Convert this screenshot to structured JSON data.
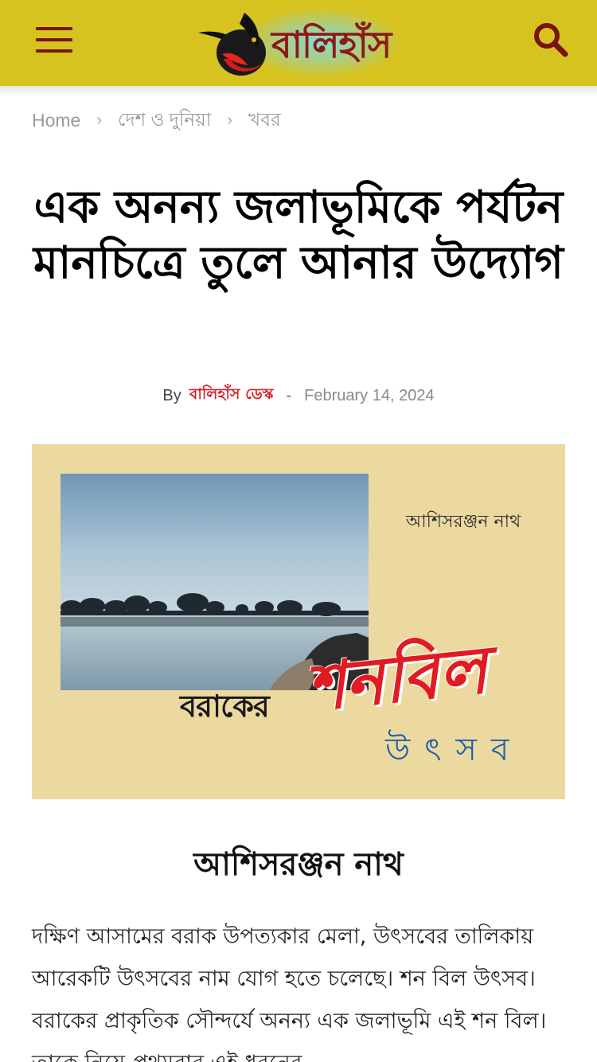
{
  "header": {
    "menu_icon": "hamburger-menu-icon",
    "logo_text": "বালিহাঁস",
    "search_icon": "search-icon",
    "bar_color": "#d6c31f",
    "brand_color": "#7a1414"
  },
  "breadcrumb": {
    "items": [
      "Home",
      "দেশ ও দুনিয়া",
      "খবর"
    ],
    "separator": "›"
  },
  "article": {
    "title": "এক অনন্য জলাভূমিকে পর্যটন মানচিত্রে তুলে আনার উদ্যোগ",
    "by_label": "By",
    "author": "বালিহাঁস ডেস্ক",
    "dash": "-",
    "date": "February 14, 2024",
    "author_color": "#d2232a",
    "hero": {
      "byline": "আশিসরঞ্জন নাথ",
      "word_barak": "বরাকের",
      "word_shonbil": "শনবিল",
      "word_utsav": "উৎসব"
    },
    "subhead": "আশিসরঞ্জন নাথ",
    "body": "দক্ষিণ আসামের বরাক উপত্যকার মেলা, উৎসবের তালিকায় আরেকটি উৎসবের নাম যোগ হতে চলেছে। শন বিল উৎসব। বরাকের প্রাকৃতিক সৌন্দর্যে অনন্য এক জলাভূমি এই শন বিল। তাকে নিয়ে প্রথমবার এই ধরনের"
  }
}
